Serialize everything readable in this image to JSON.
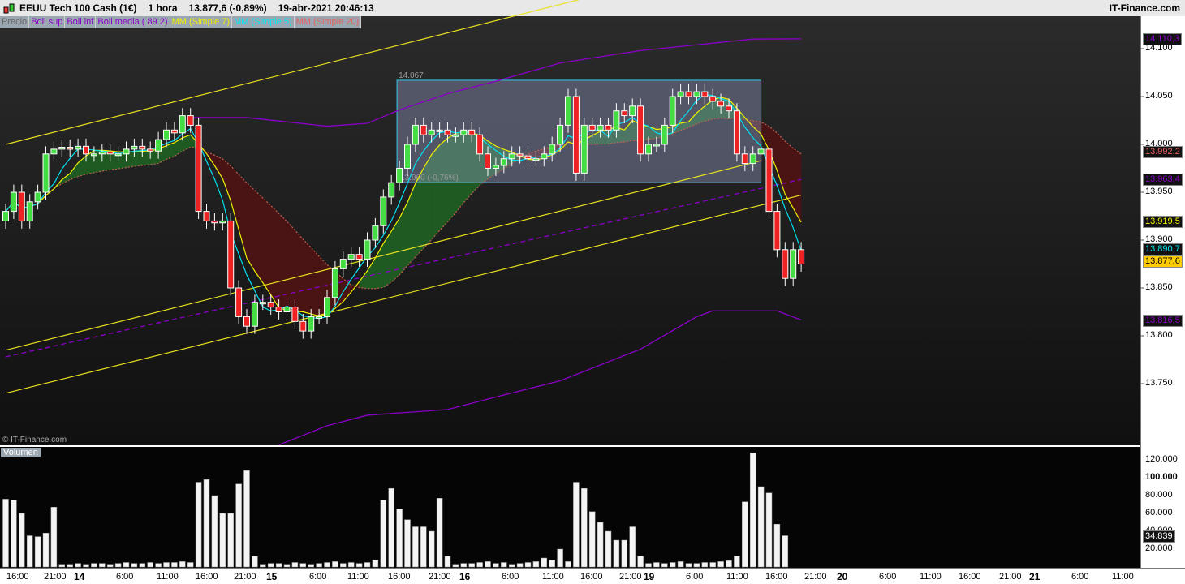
{
  "header": {
    "title": "EEUU Tech 100 Cash (1€)",
    "timeframe": "1 hora",
    "price": "13.877,6 (-0,89%)",
    "datetime": "19-abr-2021 20:46:13",
    "brand": "IT-Finance.com"
  },
  "legend": [
    {
      "label": "Precio",
      "color": "#666666"
    },
    {
      "label": "Boll sup",
      "color": "#8a00c8"
    },
    {
      "label": "Boll inf",
      "color": "#8a00c8"
    },
    {
      "label": "Boll media ( 89 2)",
      "color": "#8a00c8"
    },
    {
      "label": "MM (Simple 7)",
      "color": "#f0f000"
    },
    {
      "label": "MM (Simple 5)",
      "color": "#00e8f0"
    },
    {
      "label": "MM (Simple 20)",
      "color": "#e86060"
    }
  ],
  "watermark": "© IT-Finance.com",
  "volume_label": "Volumen",
  "rect": {
    "top_label": "14.067",
    "bottom_label": "13.960 (-0,76%)"
  },
  "price_axis": [
    "14.100",
    "14.050",
    "14.000",
    "13.950",
    "13.900",
    "13.850",
    "13.800",
    "13.750"
  ],
  "price_axis_values": [
    14100,
    14050,
    14000,
    13950,
    13900,
    13850,
    13800,
    13750
  ],
  "price_tags": [
    {
      "text": "14.110,3",
      "color": "#8a00c8",
      "bg": "#111"
    },
    {
      "text": "13.992,2",
      "color": "#e86060",
      "bg": "#111"
    },
    {
      "text": "13.963,4",
      "color": "#8a00c8",
      "bg": "#111"
    },
    {
      "text": "13.919,5",
      "color": "#f0f000",
      "bg": "#111"
    },
    {
      "text": "13.890,7",
      "color": "#00e8f0",
      "bg": "#111"
    },
    {
      "text": "13.877,6",
      "color": "#000000",
      "bg": "#ffcc00"
    },
    {
      "text": "13.816,5",
      "color": "#8a00c8",
      "bg": "#111"
    }
  ],
  "volume_axis": [
    "120.000",
    "100.000",
    "80.000",
    "60.000",
    "40.000",
    "20.000"
  ],
  "volume_tag": "34.839",
  "x_axis": [
    {
      "t": "16:00"
    },
    {
      "t": "21:00"
    },
    {
      "t": "14",
      "b": true
    },
    {
      "t": "6:00"
    },
    {
      "t": "11:00"
    },
    {
      "t": "16:00"
    },
    {
      "t": "21:00"
    },
    {
      "t": "15",
      "b": true
    },
    {
      "t": "6:00"
    },
    {
      "t": "11:00"
    },
    {
      "t": "16:00"
    },
    {
      "t": "21:00"
    },
    {
      "t": "16",
      "b": true
    },
    {
      "t": "6:00"
    },
    {
      "t": "11:00"
    },
    {
      "t": "16:00"
    },
    {
      "t": "21:00"
    },
    {
      "t": "19",
      "b": true
    },
    {
      "t": "6:00"
    },
    {
      "t": "11:00"
    },
    {
      "t": "16:00"
    },
    {
      "t": "21:00"
    },
    {
      "t": "20",
      "b": true
    },
    {
      "t": "6:00"
    },
    {
      "t": "11:00"
    },
    {
      "t": "16:00"
    },
    {
      "t": "21:00"
    },
    {
      "t": "21",
      "b": true
    },
    {
      "t": "6:00"
    },
    {
      "t": "11:00"
    }
  ],
  "chart_data": {
    "type": "candlestick",
    "closes": [
      13930,
      13950,
      13920,
      13940,
      13950,
      13990,
      13995,
      13997,
      13995,
      13998,
      13990,
      13990,
      13992,
      13990,
      13990,
      13995,
      13998,
      13995,
      13993,
      14005,
      14015,
      14012,
      14030,
      14020,
      13930,
      13920,
      13918,
      13920,
      13850,
      13820,
      13810,
      13835,
      13835,
      13830,
      13825,
      13830,
      13815,
      13805,
      13820,
      13820,
      13840,
      13870,
      13880,
      13885,
      13880,
      13900,
      13915,
      13945,
      13960,
      13975,
      14000,
      14020,
      14010,
      14015,
      14015,
      14010,
      14010,
      14015,
      14010,
      13990,
      13975,
      13978,
      13985,
      13990,
      13988,
      13985,
      13985,
      13990,
      14000,
      14020,
      14050,
      13970,
      14020,
      14015,
      14020,
      14015,
      14035,
      14030,
      14040,
      13990,
      14000,
      14000,
      14020,
      14050,
      14055,
      14050,
      14055,
      14050,
      14045,
      14040,
      14035,
      13990,
      13980,
      13990,
      13995,
      13930,
      13890,
      13860,
      13890,
      13875
    ],
    "volume_thousands": [
      76,
      75,
      60,
      35,
      34,
      38,
      67,
      3,
      3,
      4,
      3,
      4,
      4,
      3,
      4,
      5,
      4,
      4,
      5,
      4,
      5,
      5,
      6,
      5,
      95,
      98,
      80,
      60,
      60,
      93,
      108,
      12,
      3,
      4,
      4,
      3,
      5,
      4,
      3,
      4,
      5,
      6,
      4,
      5,
      4,
      5,
      8,
      75,
      88,
      65,
      53,
      45,
      45,
      40,
      77,
      12,
      3,
      4,
      4,
      5,
      6,
      4,
      5,
      3,
      4,
      5,
      6,
      10,
      8,
      20,
      6,
      95,
      88,
      62,
      50,
      40,
      30,
      30,
      45,
      12,
      4,
      5,
      4,
      5,
      6,
      4,
      4,
      5,
      5,
      6,
      7,
      12,
      73,
      128,
      90,
      83,
      48,
      35,
      0,
      0
    ],
    "boll_sup": [
      [
        23,
        14028
      ],
      [
        30,
        14028
      ],
      [
        40,
        14019
      ],
      [
        45,
        14022
      ],
      [
        49,
        14036
      ],
      [
        55,
        14053
      ],
      [
        61,
        14066
      ],
      [
        69,
        14085
      ],
      [
        79,
        14098
      ],
      [
        86,
        14104
      ],
      [
        93,
        14110
      ],
      [
        99,
        14110.3
      ]
    ],
    "boll_inf": [
      [
        34,
        13686
      ],
      [
        40,
        13706
      ],
      [
        45,
        13717
      ],
      [
        55,
        13723
      ],
      [
        61,
        13736
      ],
      [
        69,
        13753
      ],
      [
        79,
        13786
      ],
      [
        86,
        13820
      ],
      [
        88,
        13826
      ],
      [
        96,
        13826
      ],
      [
        99,
        13816.5
      ]
    ],
    "boll_media": [
      [
        0,
        13778
      ],
      [
        99,
        13963.4
      ]
    ],
    "trendlines": [
      [
        [
          0,
          14000
        ],
        [
          76,
          14161
        ]
      ],
      [
        [
          0,
          13785
        ],
        [
          94,
          13983
        ]
      ],
      [
        [
          0,
          13740
        ],
        [
          99,
          13947
        ]
      ]
    ],
    "rect": {
      "from": 49,
      "to": 94,
      "top": 14067,
      "bottom": 13960
    },
    "ylim": [
      13690,
      14150
    ],
    "vol_ylim": [
      0,
      130000
    ]
  }
}
